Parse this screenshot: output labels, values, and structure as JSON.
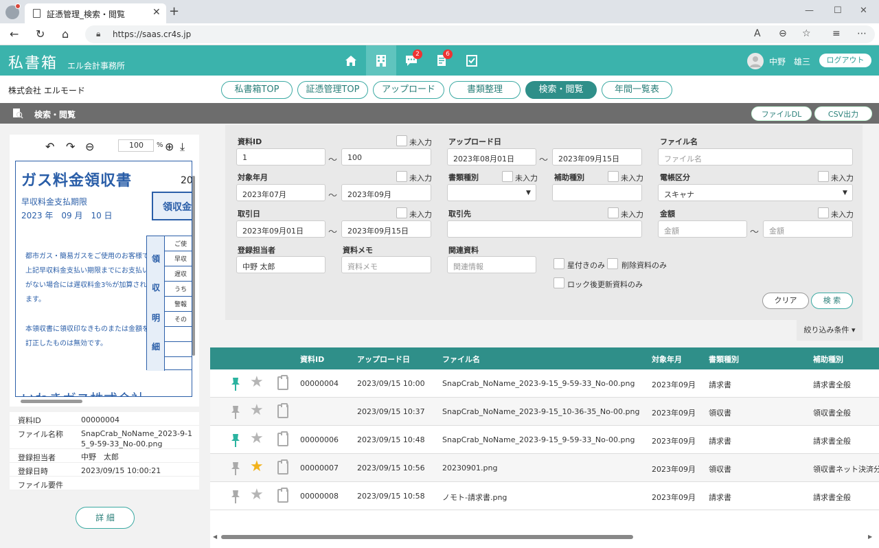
{
  "browser": {
    "tab_title": "証憑管理_検索・閲覧",
    "url": "https://saas.cr4s.jp"
  },
  "header": {
    "logo": "私書箱",
    "office": "エル会計事務所",
    "badges": {
      "messages": "2",
      "documents": "6"
    },
    "user_name": "中野　雄三",
    "logout": "ログアウト"
  },
  "company": "株式会社 エルモード",
  "nav": {
    "tabs": [
      "私書箱TOP",
      "証憑管理TOP",
      "アップロード",
      "書類整理",
      "検索・閲覧",
      "年間一覧表"
    ],
    "active": "検索・閲覧"
  },
  "section": {
    "title": "検索・閲覧",
    "file_dl": "ファイルDL",
    "csv": "CSV出力"
  },
  "viewer": {
    "zoom": "100",
    "zoom_unit": "%",
    "doc": {
      "title": "ガス料金領収書",
      "year_prefix": "20",
      "sub": "早収料金支払期限",
      "date": "2023 年　09 月　10 日",
      "receipt": "領収金",
      "note1": "都市ガス・簡易ガスをご使用のお客様で上記早収料金支払い期限までにお支払いがない場合には遅収料金3％が加算されます。",
      "note2": "本領収書に領収印なきものまたは金額を訂正したものは無効です。",
      "side_chars": [
        "領",
        "収",
        "明",
        "細"
      ],
      "cells": [
        "ご使",
        "早収",
        "遅収",
        "うち",
        "警報",
        "その"
      ],
      "bottom": "いわきガス株式会社"
    }
  },
  "info": {
    "rows": [
      {
        "key": "資料ID",
        "val": "00000004"
      },
      {
        "key": "ファイル名称",
        "val": "SnapCrab_NoName_2023-9-15_9-59-33_No-00.png"
      },
      {
        "key": "登録担当者",
        "val": "中野　太郎"
      },
      {
        "key": "登録日時",
        "val": "2023/09/15 10:00:21"
      },
      {
        "key": "ファイル要件",
        "val": ""
      }
    ],
    "detail": "詳 細"
  },
  "form": {
    "labels": {
      "doc_id": "資料ID",
      "upload_date": "アップロード日",
      "file_name": "ファイル名",
      "target_month": "対象年月",
      "doc_type": "書類種別",
      "aux_type": "補助種別",
      "ledger": "電帳区分",
      "deal_date": "取引日",
      "partner": "取引先",
      "amount": "金額",
      "registrant": "登録担当者",
      "memo": "資料メモ",
      "related": "関連資料"
    },
    "unentered": "未入力",
    "tilde": "～",
    "doc_id_from": "1",
    "doc_id_to": "100",
    "upload_from": "2023年08月01日",
    "upload_to": "2023年09月15日",
    "file_name_ph": "ファイル名",
    "month_from": "2023年07月",
    "month_to": "2023年09月",
    "ledger_value": "スキャナ",
    "deal_from": "2023年09月01日",
    "deal_to": "2023年09月15日",
    "amount_ph": "金額",
    "registrant_value": "中野 太郎",
    "memo_ph": "資料メモ",
    "related_ph": "関連情報",
    "checks": {
      "star_only": "星付きのみ",
      "deleted_only": "削除資料のみ",
      "lock_updated": "ロック後更新資料のみ"
    },
    "clear": "クリア",
    "search": "検 索",
    "filter_toggle": "絞り込み条件 ▾"
  },
  "results": {
    "headers": [
      "資料ID",
      "アップロード日",
      "ファイル名",
      "対象年月",
      "書類種別",
      "補助種別"
    ],
    "rows": [
      {
        "pinned": true,
        "starred": false,
        "id": "00000004",
        "upload": "2023/09/15 10:00",
        "file": "SnapCrab_NoName_2023-9-15_9-59-33_No-00.png",
        "month": "2023年09月",
        "type": "請求書",
        "aux": "請求書全般"
      },
      {
        "pinned": false,
        "starred": false,
        "id": "",
        "upload": "2023/09/15 10:37",
        "file": "SnapCrab_NoName_2023-9-15_10-36-35_No-00.png",
        "month": "2023年09月",
        "type": "領収書",
        "aux": "領収書全般"
      },
      {
        "pinned": true,
        "starred": false,
        "id": "00000006",
        "upload": "2023/09/15 10:48",
        "file": "SnapCrab_NoName_2023-9-15_9-59-33_No-00.png",
        "month": "2023年09月",
        "type": "請求書",
        "aux": "請求書全般"
      },
      {
        "pinned": false,
        "starred": true,
        "id": "00000007",
        "upload": "2023/09/15 10:56",
        "file": "20230901.png",
        "month": "2023年09月",
        "type": "領収書",
        "aux": "領収書ネット決済分"
      },
      {
        "pinned": false,
        "starred": false,
        "id": "00000008",
        "upload": "2023/09/15 10:58",
        "file": "ノモト-請求書.png",
        "month": "2023年09月",
        "type": "請求書",
        "aux": "請求書全般"
      }
    ]
  },
  "colors": {
    "teal": "#3bb3ac",
    "dark_teal": "#2f8f89",
    "pin_active": "#2bb3a0",
    "pin_inactive": "#aaaaaa",
    "star_active": "#f2b21b",
    "star_inactive": "#b5b5b5"
  }
}
